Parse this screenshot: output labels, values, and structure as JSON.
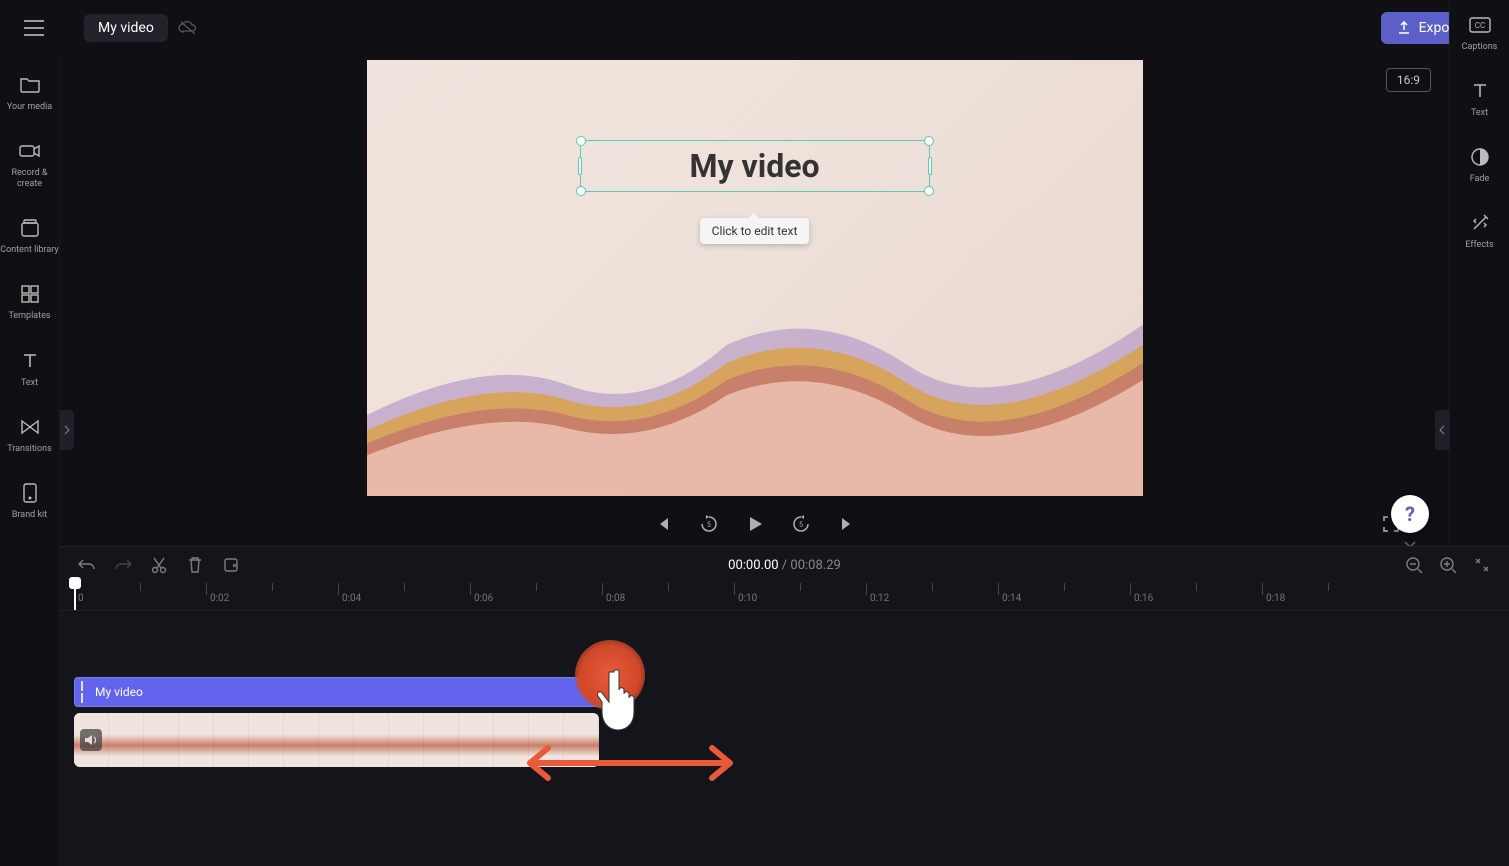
{
  "header": {
    "project_title": "My video",
    "export_label": "Export"
  },
  "left_sidebar": {
    "items": [
      {
        "label": "Your media"
      },
      {
        "label": "Record & create"
      },
      {
        "label": "Content library"
      },
      {
        "label": "Templates"
      },
      {
        "label": "Text"
      },
      {
        "label": "Transitions"
      },
      {
        "label": "Brand kit"
      }
    ]
  },
  "right_sidebar": {
    "items": [
      {
        "label": "Captions"
      },
      {
        "label": "Text"
      },
      {
        "label": "Fade"
      },
      {
        "label": "Effects"
      }
    ]
  },
  "canvas": {
    "aspect": "16:9",
    "title_text": "My video",
    "tooltip": "Click to edit text"
  },
  "timeline": {
    "current": "00:00.00",
    "separator": " / ",
    "total": "00:08.29",
    "ticks": [
      "0",
      "0:02",
      "0:04",
      "0:06",
      "0:08",
      "0:10",
      "0:12",
      "0:14",
      "0:16",
      "0:18"
    ],
    "text_clip_label": "My video"
  },
  "help": "?"
}
